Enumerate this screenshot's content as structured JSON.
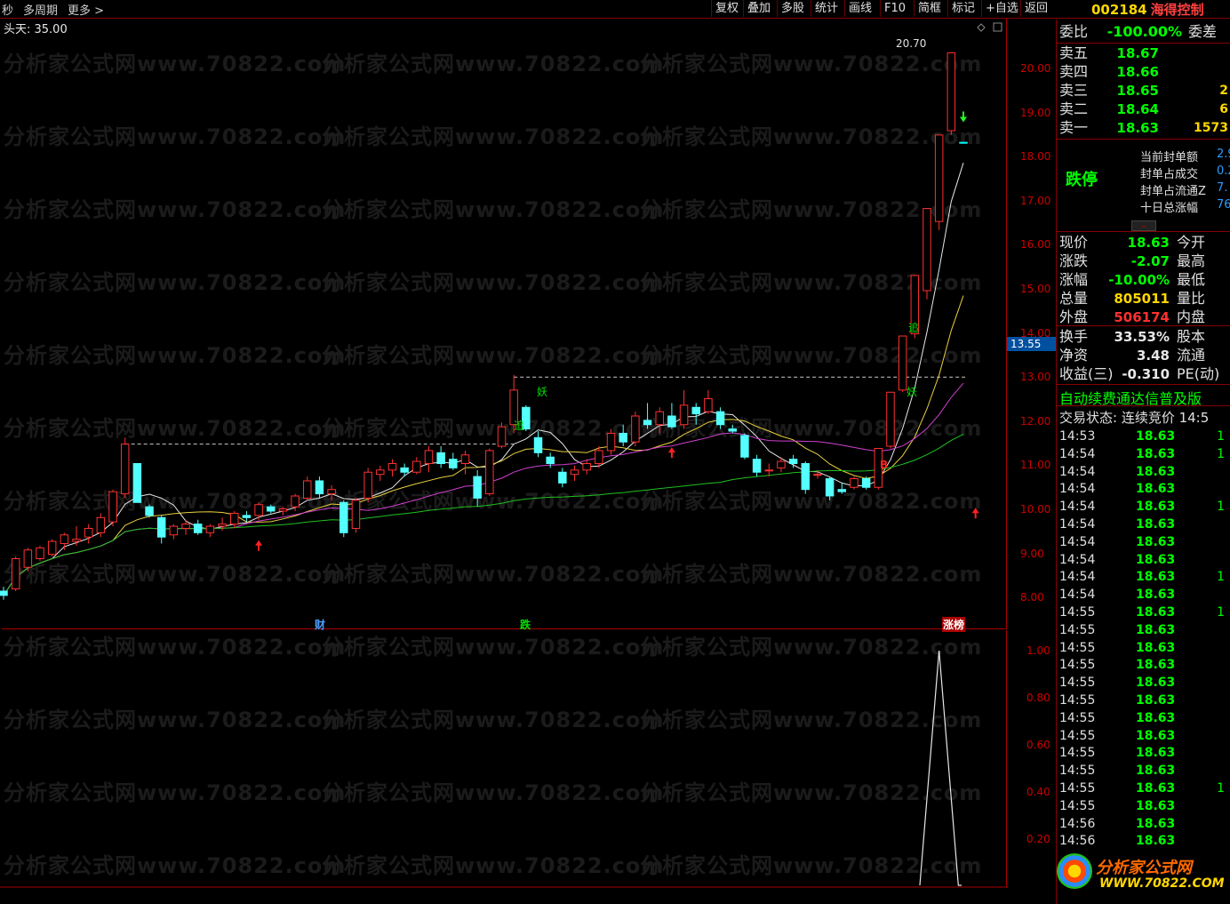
{
  "toolbar": {
    "left_items": [
      "秒",
      "多周期",
      "更多 >"
    ],
    "buttons": [
      "复权",
      "叠加",
      "多股",
      "统计",
      "画线",
      "F10",
      "简框",
      "标记",
      "+自选",
      "返回"
    ]
  },
  "stock": {
    "code": "002184",
    "name": "海得控制"
  },
  "chart_header": {
    "label": "头天: 35.00"
  },
  "watermark": "分析家公式网www.70822.com",
  "main_chart": {
    "y_ticks": [
      "20.00",
      "19.00",
      "18.00",
      "17.00",
      "16.00",
      "15.00",
      "14.00",
      "13.00",
      "12.00",
      "11.00",
      "10.00",
      "9.00",
      "8.00"
    ],
    "current_price_tag": "13.55",
    "high_label": "20.70",
    "markers": {
      "cai": "财",
      "die": "跌",
      "zhangbang": "涨榜",
      "yao": "妖",
      "zhui": "追",
      "b_mark": "B"
    }
  },
  "sub_chart": {
    "y_ticks": [
      "1.00",
      "0.80",
      "0.60",
      "0.40",
      "0.20"
    ]
  },
  "chart_data": {
    "type": "candlestick",
    "ohlc": [
      [
        8.25,
        8.35,
        8.05,
        8.15
      ],
      [
        8.3,
        9.05,
        8.25,
        9.0
      ],
      [
        8.8,
        9.25,
        8.7,
        9.2
      ],
      [
        9.0,
        9.3,
        8.95,
        9.25
      ],
      [
        9.1,
        9.45,
        9.05,
        9.4
      ],
      [
        9.35,
        9.6,
        9.2,
        9.55
      ],
      [
        9.4,
        9.75,
        9.3,
        9.45
      ],
      [
        9.5,
        9.8,
        9.35,
        9.7
      ],
      [
        9.6,
        10.05,
        9.5,
        9.95
      ],
      [
        9.85,
        10.6,
        9.75,
        10.55
      ],
      [
        10.5,
        11.8,
        10.4,
        11.65
      ],
      [
        11.2,
        11.2,
        10.3,
        10.3
      ],
      [
        10.2,
        10.25,
        9.95,
        10.0
      ],
      [
        9.95,
        10.0,
        9.35,
        9.5
      ],
      [
        9.55,
        9.8,
        9.45,
        9.75
      ],
      [
        9.7,
        9.9,
        9.55,
        9.8
      ],
      [
        9.8,
        9.9,
        9.55,
        9.6
      ],
      [
        9.6,
        9.8,
        9.5,
        9.75
      ],
      [
        9.75,
        9.95,
        9.65,
        9.8
      ],
      [
        9.8,
        10.1,
        9.7,
        10.05
      ],
      [
        10.0,
        10.1,
        9.85,
        9.95
      ],
      [
        10.0,
        10.3,
        9.9,
        10.25
      ],
      [
        10.2,
        10.25,
        10.05,
        10.1
      ],
      [
        10.1,
        10.2,
        10.0,
        10.15
      ],
      [
        10.2,
        10.5,
        10.1,
        10.45
      ],
      [
        10.4,
        10.9,
        10.35,
        10.8
      ],
      [
        10.8,
        10.9,
        10.4,
        10.5
      ],
      [
        10.5,
        10.7,
        10.35,
        10.6
      ],
      [
        10.3,
        10.35,
        9.5,
        9.6
      ],
      [
        9.7,
        10.4,
        9.6,
        10.35
      ],
      [
        10.4,
        11.1,
        10.3,
        11.0
      ],
      [
        10.95,
        11.15,
        10.8,
        11.05
      ],
      [
        11.05,
        11.3,
        10.9,
        11.2
      ],
      [
        11.1,
        11.2,
        10.9,
        11.0
      ],
      [
        11.0,
        11.35,
        10.95,
        11.25
      ],
      [
        11.2,
        11.6,
        11.0,
        11.5
      ],
      [
        11.45,
        11.6,
        11.1,
        11.2
      ],
      [
        11.3,
        11.45,
        11.05,
        11.1
      ],
      [
        11.2,
        11.5,
        10.95,
        11.4
      ],
      [
        10.9,
        11.05,
        10.2,
        10.4
      ],
      [
        10.5,
        11.55,
        10.45,
        11.5
      ],
      [
        11.6,
        12.15,
        11.55,
        12.05
      ],
      [
        12.1,
        13.25,
        11.9,
        12.9
      ],
      [
        12.5,
        12.55,
        11.95,
        12.0
      ],
      [
        11.8,
        11.95,
        11.35,
        11.45
      ],
      [
        11.35,
        11.45,
        11.1,
        11.2
      ],
      [
        11.0,
        11.1,
        10.65,
        10.75
      ],
      [
        10.95,
        11.15,
        10.8,
        11.05
      ],
      [
        11.05,
        11.3,
        10.95,
        11.2
      ],
      [
        11.2,
        11.6,
        11.1,
        11.5
      ],
      [
        11.5,
        12.0,
        11.4,
        11.9
      ],
      [
        11.9,
        12.1,
        11.6,
        11.7
      ],
      [
        11.7,
        12.4,
        11.6,
        12.3
      ],
      [
        12.2,
        12.6,
        12.0,
        12.1
      ],
      [
        12.1,
        12.5,
        11.9,
        12.4
      ],
      [
        12.3,
        12.6,
        12.0,
        12.05
      ],
      [
        12.1,
        12.9,
        12.0,
        12.55
      ],
      [
        12.5,
        12.6,
        12.1,
        12.35
      ],
      [
        12.4,
        12.9,
        12.35,
        12.7
      ],
      [
        12.4,
        12.5,
        12.0,
        12.1
      ],
      [
        12.0,
        12.1,
        11.9,
        11.95
      ],
      [
        11.85,
        11.9,
        11.3,
        11.35
      ],
      [
        11.3,
        11.4,
        10.9,
        11.0
      ],
      [
        11.05,
        11.2,
        10.9,
        11.05
      ],
      [
        11.1,
        11.35,
        11.0,
        11.25
      ],
      [
        11.3,
        11.4,
        11.1,
        11.2
      ],
      [
        11.2,
        11.25,
        10.5,
        10.6
      ],
      [
        10.95,
        11.05,
        10.85,
        10.95
      ],
      [
        10.85,
        10.9,
        10.35,
        10.45
      ],
      [
        10.6,
        10.75,
        10.5,
        10.55
      ],
      [
        10.65,
        10.9,
        10.6,
        10.85
      ],
      [
        10.85,
        10.9,
        10.6,
        10.65
      ],
      [
        10.65,
        11.55,
        10.6,
        11.55
      ],
      [
        11.6,
        12.85,
        11.55,
        12.85
      ],
      [
        12.9,
        14.15,
        12.85,
        14.15
      ],
      [
        14.2,
        15.55,
        14.1,
        15.55
      ],
      [
        15.2,
        17.1,
        15.0,
        17.1
      ],
      [
        16.8,
        18.8,
        16.6,
        18.8
      ],
      [
        18.9,
        20.7,
        18.8,
        20.7
      ],
      [
        18.63,
        18.63,
        18.63,
        18.63
      ]
    ],
    "ylim": [
      7.9,
      21.1
    ]
  },
  "panel": {
    "weibi": {
      "label": "委比",
      "value": "-100.00%",
      "label2": "委差"
    },
    "asks": [
      {
        "label": "卖五",
        "price": "18.67",
        "vol": ""
      },
      {
        "label": "卖四",
        "price": "18.66",
        "vol": ""
      },
      {
        "label": "卖三",
        "price": "18.65",
        "vol": "2"
      },
      {
        "label": "卖二",
        "price": "18.64",
        "vol": "6"
      },
      {
        "label": "卖一",
        "price": "18.63",
        "vol": "1573"
      }
    ],
    "limit_status": "跌停",
    "seal": [
      {
        "label": "当前封单额",
        "value": "2.9"
      },
      {
        "label": "封单占成交",
        "value": "0.2"
      },
      {
        "label": "封单占流通Z",
        "value": "7."
      },
      {
        "label": "十日总涨幅",
        "value": "76."
      }
    ],
    "quote": [
      {
        "label": "现价",
        "value": "18.63",
        "label2": "今开",
        "color": "#00ff00"
      },
      {
        "label": "涨跌",
        "value": "-2.07",
        "label2": "最高",
        "color": "#00ff00"
      },
      {
        "label": "涨幅",
        "value": "-10.00%",
        "label2": "最低",
        "color": "#00ff00"
      },
      {
        "label": "总量",
        "value": "805011",
        "label2": "量比",
        "color": "#ffd800"
      },
      {
        "label": "外盘",
        "value": "506174",
        "label2": "内盘",
        "color": "#ff3030"
      }
    ],
    "fin": [
      {
        "label": "换手",
        "value": "33.53%",
        "label2": "股本"
      },
      {
        "label": "净资",
        "value": "3.48",
        "label2": "流通"
      },
      {
        "label": "收益(三)",
        "value": "-0.310",
        "label2": "PE(动)"
      }
    ],
    "banner": "自动续费通达信普及版",
    "trade_status": "交易状态: 连续竞价  14:5",
    "ticks": [
      {
        "t": "14:53",
        "p": "18.63",
        "v": "1"
      },
      {
        "t": "14:54",
        "p": "18.63",
        "v": "1"
      },
      {
        "t": "14:54",
        "p": "18.63",
        "v": ""
      },
      {
        "t": "14:54",
        "p": "18.63",
        "v": ""
      },
      {
        "t": "14:54",
        "p": "18.63",
        "v": "1"
      },
      {
        "t": "14:54",
        "p": "18.63",
        "v": ""
      },
      {
        "t": "14:54",
        "p": "18.63",
        "v": ""
      },
      {
        "t": "14:54",
        "p": "18.63",
        "v": ""
      },
      {
        "t": "14:54",
        "p": "18.63",
        "v": "1"
      },
      {
        "t": "14:54",
        "p": "18.63",
        "v": ""
      },
      {
        "t": "14:55",
        "p": "18.63",
        "v": "1"
      },
      {
        "t": "14:55",
        "p": "18.63",
        "v": ""
      },
      {
        "t": "14:55",
        "p": "18.63",
        "v": ""
      },
      {
        "t": "14:55",
        "p": "18.63",
        "v": ""
      },
      {
        "t": "14:55",
        "p": "18.63",
        "v": ""
      },
      {
        "t": "14:55",
        "p": "18.63",
        "v": ""
      },
      {
        "t": "14:55",
        "p": "18.63",
        "v": ""
      },
      {
        "t": "14:55",
        "p": "18.63",
        "v": ""
      },
      {
        "t": "14:55",
        "p": "18.63",
        "v": ""
      },
      {
        "t": "14:55",
        "p": "18.63",
        "v": ""
      },
      {
        "t": "14:55",
        "p": "18.63",
        "v": "1"
      },
      {
        "t": "14:55",
        "p": "18.63",
        "v": ""
      },
      {
        "t": "14:56",
        "p": "18.63",
        "v": ""
      },
      {
        "t": "14:56",
        "p": "18.63",
        "v": ""
      }
    ],
    "logo": {
      "line1": "分析家公式网",
      "line2": "WWW.70822.COM"
    }
  }
}
